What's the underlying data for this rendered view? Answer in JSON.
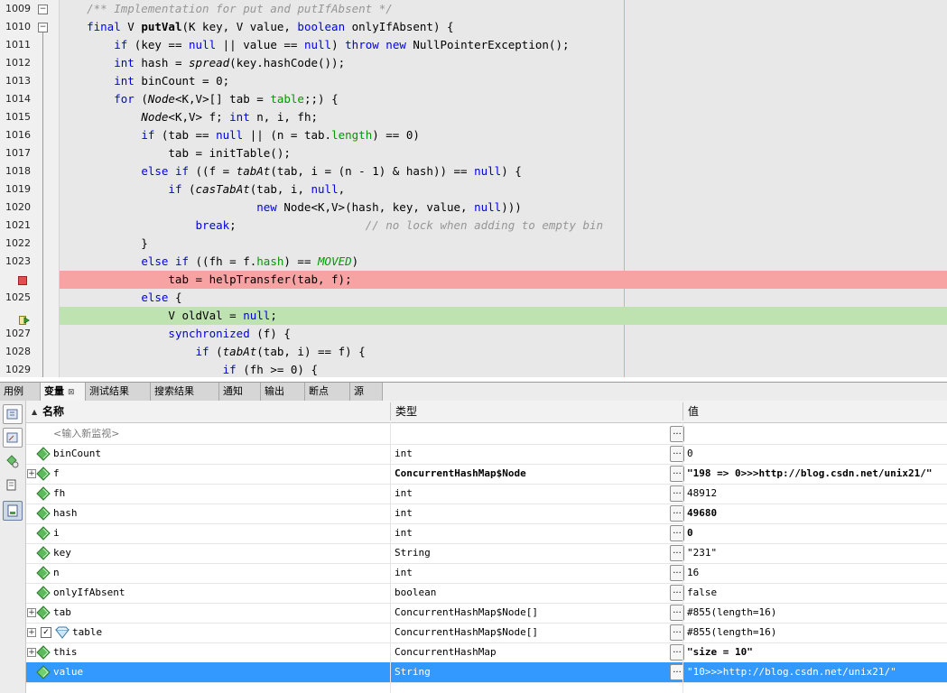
{
  "editor": {
    "lines": [
      {
        "num": "1009",
        "html": "<span class='c'>    /** Implementation for put and putIfAbsent */</span>"
      },
      {
        "num": "1010",
        "html": "    <span class='k'>final</span> V <span class='b'>putVal</span>(K key, V value, <span class='k'>boolean</span> onlyIfAbsent) {"
      },
      {
        "num": "1011",
        "html": "        <span class='k'>if</span> (key == <span class='k'>null</span> || value == <span class='k'>null</span>) <span class='k'>throw new</span> NullPointerException();"
      },
      {
        "num": "1012",
        "html": "        <span class='k'>int</span> hash = <span class='i'>spread</span>(key.hashCode());"
      },
      {
        "num": "1013",
        "html": "        <span class='k'>int</span> binCount = 0;"
      },
      {
        "num": "1014",
        "html": "        <span class='k'>for</span> (<span class='i'>Node</span>&lt;K,V&gt;[] tab = <span class='f'>table</span>;;) {"
      },
      {
        "num": "1015",
        "html": "            <span class='i'>Node</span>&lt;K,V&gt; f; <span class='k'>int</span> n, i, fh;"
      },
      {
        "num": "1016",
        "html": "            <span class='k'>if</span> (tab == <span class='k'>null</span> || (n = tab.<span class='f'>length</span>) == 0)"
      },
      {
        "num": "1017",
        "html": "                tab = initTable();"
      },
      {
        "num": "1018",
        "html": "            <span class='k'>else if</span> ((f = <span class='i'>tabAt</span>(tab, i = (n - 1) &amp; hash)) == <span class='k'>null</span>) {"
      },
      {
        "num": "1019",
        "html": "                <span class='k'>if</span> (<span class='i'>casTabAt</span>(tab, i, <span class='k'>null</span>,"
      },
      {
        "num": "1020",
        "html": "                             <span class='k'>new</span> Node&lt;K,V&gt;(hash, key, value, <span class='k'>null</span>)))"
      },
      {
        "num": "1021",
        "html": "                    <span class='k'>break</span>;                   <span class='c'>// no lock when adding to empty bin</span>"
      },
      {
        "num": "1022",
        "html": "            }"
      },
      {
        "num": "1023",
        "html": "            <span class='k'>else if</span> ((fh = f.<span class='f'>hash</span>) == <span class='fd'>MOVED</span>)"
      },
      {
        "num": "",
        "html": "                tab = helpTransfer(tab, f);"
      },
      {
        "num": "1025",
        "html": "            <span class='k'>else</span> {"
      },
      {
        "num": "",
        "html": "                V oldVal = <span class='k'>null</span>;"
      },
      {
        "num": "1027",
        "html": "                <span class='k'>synchronized</span> (f) {"
      },
      {
        "num": "1028",
        "html": "                    <span class='k'>if</span> (<span class='i'>tabAt</span>(tab, i) == f) {"
      },
      {
        "num": "1029",
        "html": "                        <span class='k'>if</span> (fh &gt;= 0) {"
      }
    ]
  },
  "tabs": [
    {
      "label": "用例"
    },
    {
      "label": "变量",
      "close": "⊠"
    },
    {
      "label": "测试结果"
    },
    {
      "label": "搜索结果"
    },
    {
      "label": "通知"
    },
    {
      "label": "输出"
    },
    {
      "label": "断点"
    },
    {
      "label": "源"
    }
  ],
  "variables": {
    "headers": {
      "name": "名称",
      "type": "类型",
      "value": "值"
    },
    "new_watch_placeholder": "<输入新监视>",
    "dots_label": "...",
    "rows": [
      {
        "name": "binCount",
        "type": "int",
        "value": "0",
        "expand": false,
        "icon": "gem",
        "bold_type": false,
        "bold_value": false
      },
      {
        "name": "f",
        "type": "ConcurrentHashMap$Node",
        "value": "\"198 => 0>>>http://blog.csdn.net/unix21/\"",
        "expand": true,
        "icon": "gem",
        "bold_type": true,
        "bold_value": true
      },
      {
        "name": "fh",
        "type": "int",
        "value": "48912",
        "expand": false,
        "icon": "gem",
        "bold_type": false,
        "bold_value": false
      },
      {
        "name": "hash",
        "type": "int",
        "value": "49680",
        "expand": false,
        "icon": "gem",
        "bold_type": false,
        "bold_value": true
      },
      {
        "name": "i",
        "type": "int",
        "value": "0",
        "expand": false,
        "icon": "gem",
        "bold_type": false,
        "bold_value": true
      },
      {
        "name": "key",
        "type": "String",
        "value": "\"231\"",
        "expand": false,
        "icon": "gem",
        "bold_type": false,
        "bold_value": false
      },
      {
        "name": "n",
        "type": "int",
        "value": "16",
        "expand": false,
        "icon": "gem",
        "bold_type": false,
        "bold_value": false
      },
      {
        "name": "onlyIfAbsent",
        "type": "boolean",
        "value": "false",
        "expand": false,
        "icon": "gem",
        "bold_type": false,
        "bold_value": false
      },
      {
        "name": "tab",
        "type": "ConcurrentHashMap$Node[]",
        "value": "#855(length=16)",
        "expand": true,
        "icon": "gem",
        "bold_type": false,
        "bold_value": false
      },
      {
        "name": "table",
        "type": "ConcurrentHashMap$Node[]",
        "value": "#855(length=16)",
        "expand": true,
        "icon": "field",
        "checkbox": true,
        "bold_type": false,
        "bold_value": false
      },
      {
        "name": "this",
        "type": "ConcurrentHashMap",
        "value": "\"size = 10\"",
        "expand": true,
        "icon": "gem",
        "bold_type": false,
        "bold_value": true
      },
      {
        "name": "value",
        "type": "String",
        "value": "\"10>>>http://blog.csdn.net/unix21/\"",
        "expand": false,
        "icon": "gem",
        "bold_type": false,
        "bold_value": false,
        "selected": true
      }
    ]
  },
  "colors": {
    "breakpoint": "#f7a3a3",
    "current_line": "#bfe3b0",
    "selection": "#3399ff",
    "keyword": "#0000e6",
    "comment": "#969696",
    "field": "#009900"
  }
}
